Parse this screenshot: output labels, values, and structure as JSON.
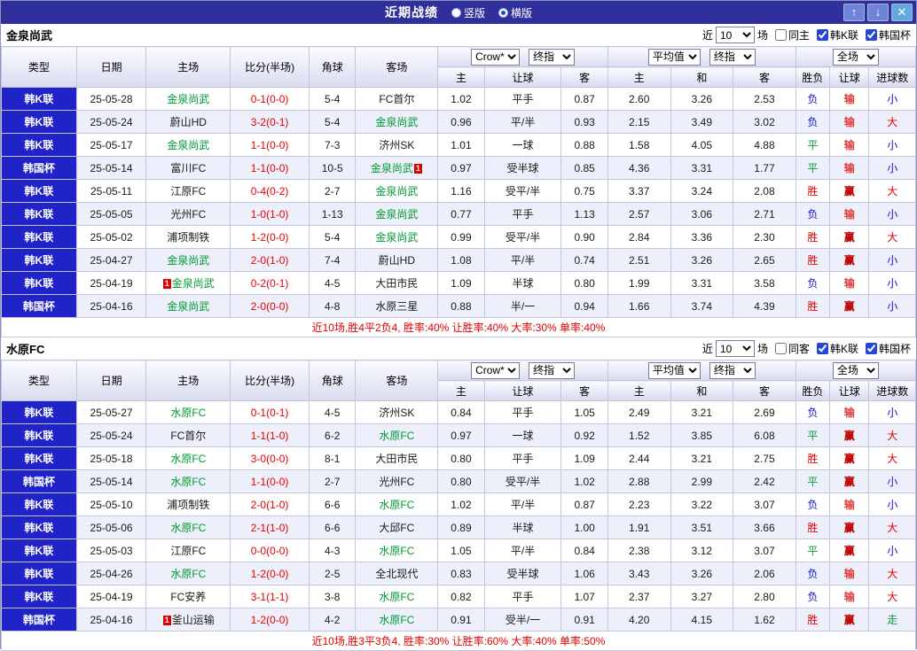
{
  "titlebar": {
    "title": "近期战绩",
    "radio_vertical": "竖版",
    "radio_horizontal": "横版",
    "up_icon": "↑",
    "down_icon": "↓",
    "close_icon": "✕"
  },
  "labels": {
    "recent": "近",
    "count": "10",
    "matches": "场",
    "league_k": "韩K联",
    "league_cup": "韩国杯"
  },
  "table_header": {
    "type": "类型",
    "date": "日期",
    "home": "主场",
    "score": "比分(半场)",
    "corner": "角球",
    "away": "客场",
    "company": "Crow*",
    "final": "终指",
    "average": "平均值",
    "full": "全场",
    "home_odds": "主",
    "handicap": "让球",
    "away_odds": "客",
    "avg_home": "主",
    "avg_draw": "和",
    "avg_away": "客",
    "result": "胜负",
    "handicap_result": "让球",
    "goals": "进球数"
  },
  "sections": [
    {
      "team": "金泉尚武",
      "same_label": "同主",
      "summary": "近10场,胜4平2负4, 胜率:40% 让胜率:40% 大率:30% 单率:40%",
      "rows": [
        {
          "league": "韩K联",
          "date": "25-05-28",
          "home": "金泉尚武",
          "home_green": true,
          "score": "0-1(0-0)",
          "corner": "5-4",
          "away": "FC首尔",
          "odds_home": "1.02",
          "handicap": "平手",
          "odds_away": "0.87",
          "avg_home": "2.60",
          "avg_draw": "3.26",
          "avg_away": "2.53",
          "result": "负",
          "handicap_result": "输",
          "goals": "小"
        },
        {
          "league": "韩K联",
          "date": "25-05-24",
          "home": "蔚山HD",
          "score": "3-2(0-1)",
          "corner": "5-4",
          "away": "金泉尚武",
          "away_green": true,
          "odds_home": "0.96",
          "handicap": "平/半",
          "odds_away": "0.93",
          "avg_home": "2.15",
          "avg_draw": "3.49",
          "avg_away": "3.02",
          "result": "负",
          "handicap_result": "输",
          "goals": "大"
        },
        {
          "league": "韩K联",
          "date": "25-05-17",
          "home": "金泉尚武",
          "home_green": true,
          "score": "1-1(0-0)",
          "corner": "7-3",
          "away": "济州SK",
          "odds_home": "1.01",
          "handicap": "一球",
          "odds_away": "0.88",
          "avg_home": "1.58",
          "avg_draw": "4.05",
          "avg_away": "4.88",
          "result": "平",
          "handicap_result": "输",
          "goals": "小"
        },
        {
          "league": "韩国杯",
          "date": "25-05-14",
          "home": "富川FC",
          "score": "1-1(0-0)",
          "corner": "10-5",
          "away": "金泉尚武",
          "away_green": true,
          "away_card": "1",
          "away_card_side": "right",
          "odds_home": "0.97",
          "handicap": "受半球",
          "odds_away": "0.85",
          "avg_home": "4.36",
          "avg_draw": "3.31",
          "avg_away": "1.77",
          "result": "平",
          "handicap_result": "输",
          "goals": "小"
        },
        {
          "league": "韩K联",
          "date": "25-05-11",
          "home": "江原FC",
          "score": "0-4(0-2)",
          "corner": "2-7",
          "away": "金泉尚武",
          "away_green": true,
          "odds_home": "1.16",
          "handicap": "受平/半",
          "odds_away": "0.75",
          "avg_home": "3.37",
          "avg_draw": "3.24",
          "avg_away": "2.08",
          "result": "胜",
          "handicap_result": "赢",
          "goals": "大"
        },
        {
          "league": "韩K联",
          "date": "25-05-05",
          "home": "光州FC",
          "score": "1-0(1-0)",
          "corner": "1-13",
          "away": "金泉尚武",
          "away_green": true,
          "odds_home": "0.77",
          "handicap": "平手",
          "odds_away": "1.13",
          "avg_home": "2.57",
          "avg_draw": "3.06",
          "avg_away": "2.71",
          "result": "负",
          "handicap_result": "输",
          "goals": "小"
        },
        {
          "league": "韩K联",
          "date": "25-05-02",
          "home": "浦项制铁",
          "score": "1-2(0-0)",
          "corner": "5-4",
          "away": "金泉尚武",
          "away_green": true,
          "odds_home": "0.99",
          "handicap": "受平/半",
          "odds_away": "0.90",
          "avg_home": "2.84",
          "avg_draw": "3.36",
          "avg_away": "2.30",
          "result": "胜",
          "handicap_result": "赢",
          "goals": "大"
        },
        {
          "league": "韩K联",
          "date": "25-04-27",
          "home": "金泉尚武",
          "home_green": true,
          "score": "2-0(1-0)",
          "corner": "7-4",
          "away": "蔚山HD",
          "odds_home": "1.08",
          "handicap": "平/半",
          "odds_away": "0.74",
          "avg_home": "2.51",
          "avg_draw": "3.26",
          "avg_away": "2.65",
          "result": "胜",
          "handicap_result": "赢",
          "goals": "小"
        },
        {
          "league": "韩K联",
          "date": "25-04-19",
          "home": "金泉尚武",
          "home_green": true,
          "home_card": "1",
          "home_card_side": "left",
          "score": "0-2(0-1)",
          "corner": "4-5",
          "away": "大田市民",
          "odds_home": "1.09",
          "handicap": "半球",
          "odds_away": "0.80",
          "avg_home": "1.99",
          "avg_draw": "3.31",
          "avg_away": "3.58",
          "result": "负",
          "handicap_result": "输",
          "goals": "小"
        },
        {
          "league": "韩国杯",
          "date": "25-04-16",
          "home": "金泉尚武",
          "home_green": true,
          "score": "2-0(0-0)",
          "corner": "4-8",
          "away": "水原三星",
          "odds_home": "0.88",
          "handicap": "半/一",
          "odds_away": "0.94",
          "avg_home": "1.66",
          "avg_draw": "3.74",
          "avg_away": "4.39",
          "result": "胜",
          "handicap_result": "赢",
          "goals": "小"
        }
      ]
    },
    {
      "team": "水原FC",
      "same_label": "同客",
      "summary": "近10场,胜3平3负4, 胜率:30% 让胜率:60% 大率:40% 单率:50%",
      "rows": [
        {
          "league": "韩K联",
          "date": "25-05-27",
          "home": "水原FC",
          "home_green": true,
          "score": "0-1(0-1)",
          "corner": "4-5",
          "away": "济州SK",
          "odds_home": "0.84",
          "handicap": "平手",
          "odds_away": "1.05",
          "avg_home": "2.49",
          "avg_draw": "3.21",
          "avg_away": "2.69",
          "result": "负",
          "handicap_result": "输",
          "goals": "小"
        },
        {
          "league": "韩K联",
          "date": "25-05-24",
          "home": "FC首尔",
          "score": "1-1(1-0)",
          "corner": "6-2",
          "away": "水原FC",
          "away_green": true,
          "odds_home": "0.97",
          "handicap": "一球",
          "odds_away": "0.92",
          "avg_home": "1.52",
          "avg_draw": "3.85",
          "avg_away": "6.08",
          "result": "平",
          "handicap_result": "赢",
          "goals": "大"
        },
        {
          "league": "韩K联",
          "date": "25-05-18",
          "home": "水原FC",
          "home_green": true,
          "score": "3-0(0-0)",
          "corner": "8-1",
          "away": "大田市民",
          "odds_home": "0.80",
          "handicap": "平手",
          "odds_away": "1.09",
          "avg_home": "2.44",
          "avg_draw": "3.21",
          "avg_away": "2.75",
          "result": "胜",
          "handicap_result": "赢",
          "goals": "大"
        },
        {
          "league": "韩国杯",
          "date": "25-05-14",
          "home": "水原FC",
          "home_green": true,
          "score": "1-1(0-0)",
          "corner": "2-7",
          "away": "光州FC",
          "odds_home": "0.80",
          "handicap": "受平/半",
          "odds_away": "1.02",
          "avg_home": "2.88",
          "avg_draw": "2.99",
          "avg_away": "2.42",
          "result": "平",
          "handicap_result": "赢",
          "goals": "小"
        },
        {
          "league": "韩K联",
          "date": "25-05-10",
          "home": "浦项制铁",
          "score": "2-0(1-0)",
          "corner": "6-6",
          "away": "水原FC",
          "away_green": true,
          "odds_home": "1.02",
          "handicap": "平/半",
          "odds_away": "0.87",
          "avg_home": "2.23",
          "avg_draw": "3.22",
          "avg_away": "3.07",
          "result": "负",
          "handicap_result": "输",
          "goals": "小"
        },
        {
          "league": "韩K联",
          "date": "25-05-06",
          "home": "水原FC",
          "home_green": true,
          "score": "2-1(1-0)",
          "corner": "6-6",
          "away": "大邱FC",
          "odds_home": "0.89",
          "handicap": "半球",
          "odds_away": "1.00",
          "avg_home": "1.91",
          "avg_draw": "3.51",
          "avg_away": "3.66",
          "result": "胜",
          "handicap_result": "赢",
          "goals": "大"
        },
        {
          "league": "韩K联",
          "date": "25-05-03",
          "home": "江原FC",
          "score": "0-0(0-0)",
          "corner": "4-3",
          "away": "水原FC",
          "away_green": true,
          "odds_home": "1.05",
          "handicap": "平/半",
          "odds_away": "0.84",
          "avg_home": "2.38",
          "avg_draw": "3.12",
          "avg_away": "3.07",
          "result": "平",
          "handicap_result": "赢",
          "goals": "小"
        },
        {
          "league": "韩K联",
          "date": "25-04-26",
          "home": "水原FC",
          "home_green": true,
          "score": "1-2(0-0)",
          "corner": "2-5",
          "away": "全北现代",
          "odds_home": "0.83",
          "handicap": "受半球",
          "odds_away": "1.06",
          "avg_home": "3.43",
          "avg_draw": "3.26",
          "avg_away": "2.06",
          "result": "负",
          "handicap_result": "输",
          "goals": "大"
        },
        {
          "league": "韩K联",
          "date": "25-04-19",
          "home": "FC安养",
          "score": "3-1(1-1)",
          "corner": "3-8",
          "away": "水原FC",
          "away_green": true,
          "odds_home": "0.82",
          "handicap": "平手",
          "odds_away": "1.07",
          "avg_home": "2.37",
          "avg_draw": "3.27",
          "avg_away": "2.80",
          "result": "负",
          "handicap_result": "输",
          "goals": "大"
        },
        {
          "league": "韩国杯",
          "date": "25-04-16",
          "home": "釜山运输",
          "home_card": "1",
          "home_card_side": "left",
          "score": "1-2(0-0)",
          "corner": "4-2",
          "away": "水原FC",
          "away_green": true,
          "odds_home": "0.91",
          "handicap": "受半/一",
          "odds_away": "0.91",
          "avg_home": "4.20",
          "avg_draw": "4.15",
          "avg_away": "1.62",
          "result": "胜",
          "handicap_result": "赢",
          "goals": "走"
        }
      ]
    }
  ]
}
